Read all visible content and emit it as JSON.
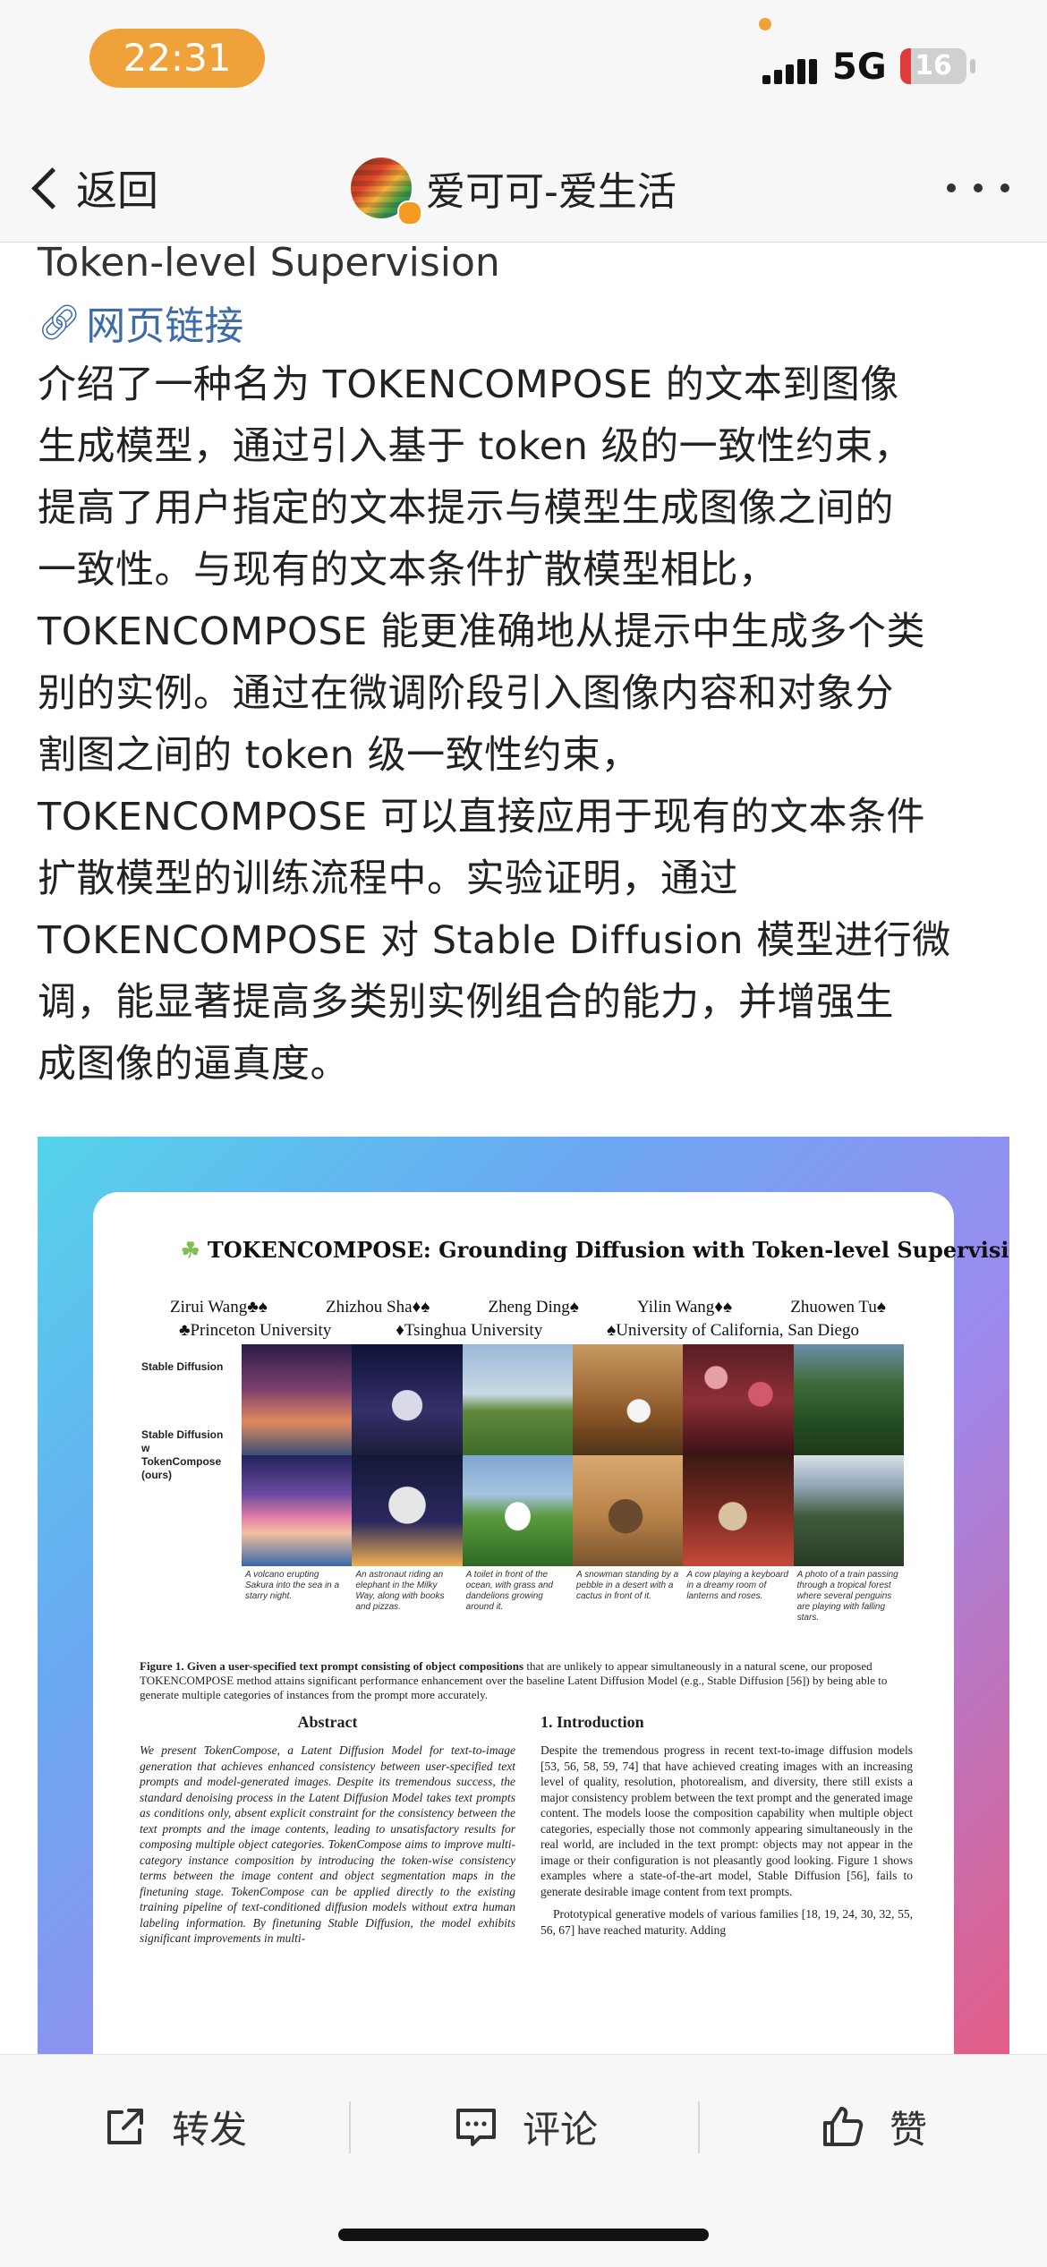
{
  "status_bar": {
    "time": "22:31",
    "network": "5G",
    "battery_level": "16",
    "battery_fraction": 0.16,
    "icons": [
      "cellular-signal-icon",
      "battery-icon"
    ]
  },
  "nav": {
    "back_label": "返回",
    "title": "爱可可-爱生活",
    "icons": [
      "chevron-left-icon",
      "avatar",
      "verified-badge-icon",
      "more-icon"
    ]
  },
  "post": {
    "subtitle": "Token-level Supervision",
    "link_icon": "link-icon",
    "link_text": "网页链接",
    "body_lines": [
      "介绍了一种名为 TOKENCOMPOSE 的文本到图像",
      "生成模型，通过引入基于 token 级的一致性约束，",
      "提高了用户指定的文本提示与模型生成图像之间的",
      "一致性。与现有的文本条件扩散模型相比，",
      "TOKENCOMPOSE 能更准确地从提示中生成多个类",
      "别的实例。通过在微调阶段引入图像内容和对象分",
      "割图之间的 token 级一致性约束，",
      "TOKENCOMPOSE 可以直接应用于现有的文本条件",
      "扩散模型的训练流程中。实验证明，通过",
      "TOKENCOMPOSE 对 Stable Diffusion 模型进行微",
      "调，能显著提高多类别实例组合的能力，并增强生",
      "成图像的逼真度。"
    ]
  },
  "paper": {
    "title": "TOKENCOMPOSE: Grounding Diffusion with Token-level Supervision",
    "authors": [
      "Zirui Wang♣♠",
      "Zhizhou Sha♦♠",
      "Zheng Ding♠",
      "Yilin Wang♦♠",
      "Zhuowen Tu♠"
    ],
    "affiliations": [
      "♣Princeton University",
      "♦Tsinghua University",
      "♠University of California, San Diego"
    ],
    "row_labels": [
      "Stable Diffusion",
      "Stable Diffusion w TokenCompose (ours)"
    ],
    "prompts": [
      "A volcano erupting Sakura into the sea in a starry night.",
      "An astronaut riding an elephant in the Milky Way, along with books and pizzas.",
      "A toilet in front of the ocean, with grass and dandelions growing around it.",
      "A snowman standing by a pebble in a desert with a cactus in front of it.",
      "A cow playing a keyboard in a dreamy room of lanterns and roses.",
      "A photo of a train passing through a tropical forest where several penguins are playing with falling stars."
    ],
    "figure_caption_bold": "Figure 1. Given a user-specified text prompt consisting of object compositions",
    "figure_caption_rest": " that are unlikely to appear simultaneously in a natural scene, our proposed TOKENCOMPOSE method attains significant performance enhancement over the baseline Latent Diffusion Model (e.g., Stable Diffusion [56]) by being able to generate multiple categories of instances from the prompt more accurately.",
    "abstract_heading": "Abstract",
    "abstract_text": "We present TokenCompose, a Latent Diffusion Model for text-to-image generation that achieves enhanced consistency between user-specified text prompts and model-generated images. Despite its tremendous success, the standard denoising process in the Latent Diffusion Model takes text prompts as conditions only, absent explicit constraint for the consistency between the text prompts and the image contents, leading to unsatisfactory results for composing multiple object categories. TokenCompose aims to improve multi-category instance composition by introducing the token-wise consistency terms between the image content and object segmentation maps in the finetuning stage. TokenCompose can be applied directly to the existing training pipeline of text-conditioned diffusion models without extra human labeling information. By finetuning Stable Diffusion, the model exhibits significant improvements in multi-",
    "intro_heading": "1. Introduction",
    "intro_para1": "Despite the tremendous progress in recent text-to-image diffusion models [53, 56, 58, 59, 74] that have achieved creating images with an increasing level of quality, resolution, photorealism, and diversity, there still exists a major consistency problem between the text prompt and the generated image content. The models loose the composition capability when multiple object categories, especially those not commonly appearing simultaneously in the real world, are included in the text prompt: objects may not appear in the image or their configuration is not pleasantly good looking. Figure 1 shows examples where a state-of-the-art model, Stable Diffusion [56], fails to generate desirable image content from text prompts.",
    "intro_para2": "Prototypical generative models of various families [18, 19, 24, 30, 32, 55, 56, 67] have reached maturity. Adding"
  },
  "toolbar": {
    "share_label": "转发",
    "comment_label": "评论",
    "like_label": "赞",
    "icons": [
      "share-icon",
      "comment-icon",
      "thumbs-up-icon"
    ]
  },
  "colors": {
    "accent_orange": "#f0a23a",
    "link_blue": "#3d6ca8",
    "battery_red": "#e03b3b",
    "background": "#ffffff",
    "bar_background": "#f7f7f7"
  }
}
